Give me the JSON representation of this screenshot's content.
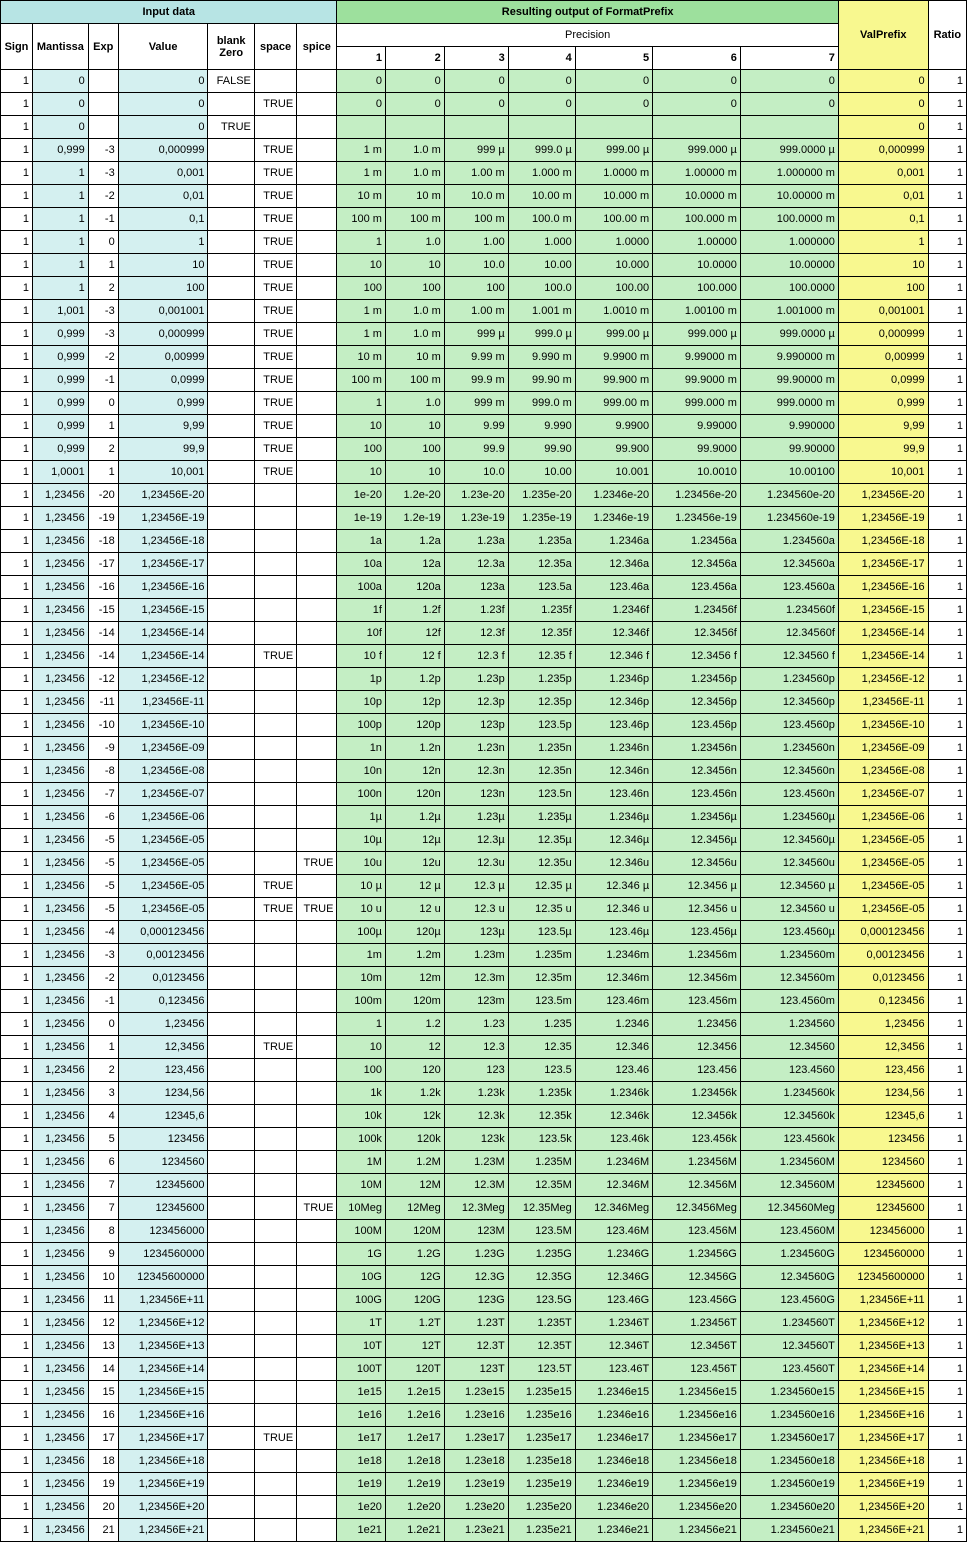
{
  "headers": {
    "input": "Input data",
    "output": "Resulting output of FormatPrefix",
    "precision": "Precision",
    "valprefix": "ValPrefix",
    "ratio": "Ratio",
    "sign": "Sign",
    "mantissa": "Mantissa",
    "exp": "Exp",
    "value": "Value",
    "blankzero1": "blank",
    "blankzero2": "Zero",
    "space": "space",
    "spice": "spice",
    "p": [
      "1",
      "2",
      "3",
      "4",
      "5",
      "6",
      "7"
    ]
  },
  "rows": [
    [
      "1",
      "0",
      "",
      "0",
      "FALSE",
      "",
      "",
      "0",
      "0",
      "0",
      "0",
      "0",
      "0",
      "0",
      "0",
      "1"
    ],
    [
      "1",
      "0",
      "",
      "0",
      "",
      "TRUE",
      "",
      "0",
      "0",
      "0",
      "0",
      "0",
      "0",
      "0",
      "0",
      "1"
    ],
    [
      "1",
      "0",
      "",
      "0",
      "TRUE",
      "",
      "",
      "",
      "",
      "",
      "",
      "",
      "",
      "",
      "0",
      "1"
    ],
    [
      "1",
      "0,999",
      "-3",
      "0,000999",
      "",
      "TRUE",
      "",
      "1 m",
      "1.0 m",
      "999 µ",
      "999.0 µ",
      "999.00 µ",
      "999.000 µ",
      "999.0000 µ",
      "0,000999",
      "1"
    ],
    [
      "1",
      "1",
      "-3",
      "0,001",
      "",
      "TRUE",
      "",
      "1 m",
      "1.0 m",
      "1.00 m",
      "1.000 m",
      "1.0000 m",
      "1.00000 m",
      "1.000000 m",
      "0,001",
      "1"
    ],
    [
      "1",
      "1",
      "-2",
      "0,01",
      "",
      "TRUE",
      "",
      "10 m",
      "10 m",
      "10.0 m",
      "10.00 m",
      "10.000 m",
      "10.0000 m",
      "10.00000 m",
      "0,01",
      "1"
    ],
    [
      "1",
      "1",
      "-1",
      "0,1",
      "",
      "TRUE",
      "",
      "100 m",
      "100 m",
      "100 m",
      "100.0 m",
      "100.00 m",
      "100.000 m",
      "100.0000 m",
      "0,1",
      "1"
    ],
    [
      "1",
      "1",
      "0",
      "1",
      "",
      "TRUE",
      "",
      "1",
      "1.0",
      "1.00",
      "1.000",
      "1.0000",
      "1.00000",
      "1.000000",
      "1",
      "1"
    ],
    [
      "1",
      "1",
      "1",
      "10",
      "",
      "TRUE",
      "",
      "10",
      "10",
      "10.0",
      "10.00",
      "10.000",
      "10.0000",
      "10.00000",
      "10",
      "1"
    ],
    [
      "1",
      "1",
      "2",
      "100",
      "",
      "TRUE",
      "",
      "100",
      "100",
      "100",
      "100.0",
      "100.00",
      "100.000",
      "100.0000",
      "100",
      "1"
    ],
    [
      "1",
      "1,001",
      "-3",
      "0,001001",
      "",
      "TRUE",
      "",
      "1 m",
      "1.0 m",
      "1.00 m",
      "1.001 m",
      "1.0010 m",
      "1.00100 m",
      "1.001000 m",
      "0,001001",
      "1"
    ],
    [
      "1",
      "0,999",
      "-3",
      "0,000999",
      "",
      "TRUE",
      "",
      "1 m",
      "1.0 m",
      "999 µ",
      "999.0 µ",
      "999.00 µ",
      "999.000 µ",
      "999.0000 µ",
      "0,000999",
      "1"
    ],
    [
      "1",
      "0,999",
      "-2",
      "0,00999",
      "",
      "TRUE",
      "",
      "10 m",
      "10 m",
      "9.99 m",
      "9.990 m",
      "9.9900 m",
      "9.99000 m",
      "9.990000 m",
      "0,00999",
      "1"
    ],
    [
      "1",
      "0,999",
      "-1",
      "0,0999",
      "",
      "TRUE",
      "",
      "100 m",
      "100 m",
      "99.9 m",
      "99.90 m",
      "99.900 m",
      "99.9000 m",
      "99.90000 m",
      "0,0999",
      "1"
    ],
    [
      "1",
      "0,999",
      "0",
      "0,999",
      "",
      "TRUE",
      "",
      "1",
      "1.0",
      "999 m",
      "999.0 m",
      "999.00 m",
      "999.000 m",
      "999.0000 m",
      "0,999",
      "1"
    ],
    [
      "1",
      "0,999",
      "1",
      "9,99",
      "",
      "TRUE",
      "",
      "10",
      "10",
      "9.99",
      "9.990",
      "9.9900",
      "9.99000",
      "9.990000",
      "9,99",
      "1"
    ],
    [
      "1",
      "0,999",
      "2",
      "99,9",
      "",
      "TRUE",
      "",
      "100",
      "100",
      "99.9",
      "99.90",
      "99.900",
      "99.9000",
      "99.90000",
      "99,9",
      "1"
    ],
    [
      "1",
      "1,0001",
      "1",
      "10,001",
      "",
      "TRUE",
      "",
      "10",
      "10",
      "10.0",
      "10.00",
      "10.001",
      "10.0010",
      "10.00100",
      "10,001",
      "1"
    ],
    [
      "1",
      "1,23456",
      "-20",
      "1,23456E-20",
      "",
      "",
      "",
      "1e-20",
      "1.2e-20",
      "1.23e-20",
      "1.235e-20",
      "1.2346e-20",
      "1.23456e-20",
      "1.234560e-20",
      "1,23456E-20",
      "1"
    ],
    [
      "1",
      "1,23456",
      "-19",
      "1,23456E-19",
      "",
      "",
      "",
      "1e-19",
      "1.2e-19",
      "1.23e-19",
      "1.235e-19",
      "1.2346e-19",
      "1.23456e-19",
      "1.234560e-19",
      "1,23456E-19",
      "1"
    ],
    [
      "1",
      "1,23456",
      "-18",
      "1,23456E-18",
      "",
      "",
      "",
      "1a",
      "1.2a",
      "1.23a",
      "1.235a",
      "1.2346a",
      "1.23456a",
      "1.234560a",
      "1,23456E-18",
      "1"
    ],
    [
      "1",
      "1,23456",
      "-17",
      "1,23456E-17",
      "",
      "",
      "",
      "10a",
      "12a",
      "12.3a",
      "12.35a",
      "12.346a",
      "12.3456a",
      "12.34560a",
      "1,23456E-17",
      "1"
    ],
    [
      "1",
      "1,23456",
      "-16",
      "1,23456E-16",
      "",
      "",
      "",
      "100a",
      "120a",
      "123a",
      "123.5a",
      "123.46a",
      "123.456a",
      "123.4560a",
      "1,23456E-16",
      "1"
    ],
    [
      "1",
      "1,23456",
      "-15",
      "1,23456E-15",
      "",
      "",
      "",
      "1f",
      "1.2f",
      "1.23f",
      "1.235f",
      "1.2346f",
      "1.23456f",
      "1.234560f",
      "1,23456E-15",
      "1"
    ],
    [
      "1",
      "1,23456",
      "-14",
      "1,23456E-14",
      "",
      "",
      "",
      "10f",
      "12f",
      "12.3f",
      "12.35f",
      "12.346f",
      "12.3456f",
      "12.34560f",
      "1,23456E-14",
      "1"
    ],
    [
      "1",
      "1,23456",
      "-14",
      "1,23456E-14",
      "",
      "TRUE",
      "",
      "10 f",
      "12 f",
      "12.3 f",
      "12.35 f",
      "12.346 f",
      "12.3456 f",
      "12.34560 f",
      "1,23456E-14",
      "1"
    ],
    [
      "1",
      "1,23456",
      "-12",
      "1,23456E-12",
      "",
      "",
      "",
      "1p",
      "1.2p",
      "1.23p",
      "1.235p",
      "1.2346p",
      "1.23456p",
      "1.234560p",
      "1,23456E-12",
      "1"
    ],
    [
      "1",
      "1,23456",
      "-11",
      "1,23456E-11",
      "",
      "",
      "",
      "10p",
      "12p",
      "12.3p",
      "12.35p",
      "12.346p",
      "12.3456p",
      "12.34560p",
      "1,23456E-11",
      "1"
    ],
    [
      "1",
      "1,23456",
      "-10",
      "1,23456E-10",
      "",
      "",
      "",
      "100p",
      "120p",
      "123p",
      "123.5p",
      "123.46p",
      "123.456p",
      "123.4560p",
      "1,23456E-10",
      "1"
    ],
    [
      "1",
      "1,23456",
      "-9",
      "1,23456E-09",
      "",
      "",
      "",
      "1n",
      "1.2n",
      "1.23n",
      "1.235n",
      "1.2346n",
      "1.23456n",
      "1.234560n",
      "1,23456E-09",
      "1"
    ],
    [
      "1",
      "1,23456",
      "-8",
      "1,23456E-08",
      "",
      "",
      "",
      "10n",
      "12n",
      "12.3n",
      "12.35n",
      "12.346n",
      "12.3456n",
      "12.34560n",
      "1,23456E-08",
      "1"
    ],
    [
      "1",
      "1,23456",
      "-7",
      "1,23456E-07",
      "",
      "",
      "",
      "100n",
      "120n",
      "123n",
      "123.5n",
      "123.46n",
      "123.456n",
      "123.4560n",
      "1,23456E-07",
      "1"
    ],
    [
      "1",
      "1,23456",
      "-6",
      "1,23456E-06",
      "",
      "",
      "",
      "1µ",
      "1.2µ",
      "1.23µ",
      "1.235µ",
      "1.2346µ",
      "1.23456µ",
      "1.234560µ",
      "1,23456E-06",
      "1"
    ],
    [
      "1",
      "1,23456",
      "-5",
      "1,23456E-05",
      "",
      "",
      "",
      "10µ",
      "12µ",
      "12.3µ",
      "12.35µ",
      "12.346µ",
      "12.3456µ",
      "12.34560µ",
      "1,23456E-05",
      "1"
    ],
    [
      "1",
      "1,23456",
      "-5",
      "1,23456E-05",
      "",
      "",
      "TRUE",
      "10u",
      "12u",
      "12.3u",
      "12.35u",
      "12.346u",
      "12.3456u",
      "12.34560u",
      "1,23456E-05",
      "1"
    ],
    [
      "1",
      "1,23456",
      "-5",
      "1,23456E-05",
      "",
      "TRUE",
      "",
      "10 µ",
      "12 µ",
      "12.3 µ",
      "12.35 µ",
      "12.346 µ",
      "12.3456 µ",
      "12.34560 µ",
      "1,23456E-05",
      "1"
    ],
    [
      "1",
      "1,23456",
      "-5",
      "1,23456E-05",
      "",
      "TRUE",
      "TRUE",
      "10 u",
      "12 u",
      "12.3 u",
      "12.35 u",
      "12.346 u",
      "12.3456 u",
      "12.34560 u",
      "1,23456E-05",
      "1"
    ],
    [
      "1",
      "1,23456",
      "-4",
      "0,000123456",
      "",
      "",
      "",
      "100µ",
      "120µ",
      "123µ",
      "123.5µ",
      "123.46µ",
      "123.456µ",
      "123.4560µ",
      "0,000123456",
      "1"
    ],
    [
      "1",
      "1,23456",
      "-3",
      "0,00123456",
      "",
      "",
      "",
      "1m",
      "1.2m",
      "1.23m",
      "1.235m",
      "1.2346m",
      "1.23456m",
      "1.234560m",
      "0,00123456",
      "1"
    ],
    [
      "1",
      "1,23456",
      "-2",
      "0,0123456",
      "",
      "",
      "",
      "10m",
      "12m",
      "12.3m",
      "12.35m",
      "12.346m",
      "12.3456m",
      "12.34560m",
      "0,0123456",
      "1"
    ],
    [
      "1",
      "1,23456",
      "-1",
      "0,123456",
      "",
      "",
      "",
      "100m",
      "120m",
      "123m",
      "123.5m",
      "123.46m",
      "123.456m",
      "123.4560m",
      "0,123456",
      "1"
    ],
    [
      "1",
      "1,23456",
      "0",
      "1,23456",
      "",
      "",
      "",
      "1",
      "1.2",
      "1.23",
      "1.235",
      "1.2346",
      "1.23456",
      "1.234560",
      "1,23456",
      "1"
    ],
    [
      "1",
      "1,23456",
      "1",
      "12,3456",
      "",
      "TRUE",
      "",
      "10",
      "12",
      "12.3",
      "12.35",
      "12.346",
      "12.3456",
      "12.34560",
      "12,3456",
      "1"
    ],
    [
      "1",
      "1,23456",
      "2",
      "123,456",
      "",
      "",
      "",
      "100",
      "120",
      "123",
      "123.5",
      "123.46",
      "123.456",
      "123.4560",
      "123,456",
      "1"
    ],
    [
      "1",
      "1,23456",
      "3",
      "1234,56",
      "",
      "",
      "",
      "1k",
      "1.2k",
      "1.23k",
      "1.235k",
      "1.2346k",
      "1.23456k",
      "1.234560k",
      "1234,56",
      "1"
    ],
    [
      "1",
      "1,23456",
      "4",
      "12345,6",
      "",
      "",
      "",
      "10k",
      "12k",
      "12.3k",
      "12.35k",
      "12.346k",
      "12.3456k",
      "12.34560k",
      "12345,6",
      "1"
    ],
    [
      "1",
      "1,23456",
      "5",
      "123456",
      "",
      "",
      "",
      "100k",
      "120k",
      "123k",
      "123.5k",
      "123.46k",
      "123.456k",
      "123.4560k",
      "123456",
      "1"
    ],
    [
      "1",
      "1,23456",
      "6",
      "1234560",
      "",
      "",
      "",
      "1M",
      "1.2M",
      "1.23M",
      "1.235M",
      "1.2346M",
      "1.23456M",
      "1.234560M",
      "1234560",
      "1"
    ],
    [
      "1",
      "1,23456",
      "7",
      "12345600",
      "",
      "",
      "",
      "10M",
      "12M",
      "12.3M",
      "12.35M",
      "12.346M",
      "12.3456M",
      "12.34560M",
      "12345600",
      "1"
    ],
    [
      "1",
      "1,23456",
      "7",
      "12345600",
      "",
      "",
      "TRUE",
      "10Meg",
      "12Meg",
      "12.3Meg",
      "12.35Meg",
      "12.346Meg",
      "12.3456Meg",
      "12.34560Meg",
      "12345600",
      "1"
    ],
    [
      "1",
      "1,23456",
      "8",
      "123456000",
      "",
      "",
      "",
      "100M",
      "120M",
      "123M",
      "123.5M",
      "123.46M",
      "123.456M",
      "123.4560M",
      "123456000",
      "1"
    ],
    [
      "1",
      "1,23456",
      "9",
      "1234560000",
      "",
      "",
      "",
      "1G",
      "1.2G",
      "1.23G",
      "1.235G",
      "1.2346G",
      "1.23456G",
      "1.234560G",
      "1234560000",
      "1"
    ],
    [
      "1",
      "1,23456",
      "10",
      "12345600000",
      "",
      "",
      "",
      "10G",
      "12G",
      "12.3G",
      "12.35G",
      "12.346G",
      "12.3456G",
      "12.34560G",
      "12345600000",
      "1"
    ],
    [
      "1",
      "1,23456",
      "11",
      "1,23456E+11",
      "",
      "",
      "",
      "100G",
      "120G",
      "123G",
      "123.5G",
      "123.46G",
      "123.456G",
      "123.4560G",
      "1,23456E+11",
      "1"
    ],
    [
      "1",
      "1,23456",
      "12",
      "1,23456E+12",
      "",
      "",
      "",
      "1T",
      "1.2T",
      "1.23T",
      "1.235T",
      "1.2346T",
      "1.23456T",
      "1.234560T",
      "1,23456E+12",
      "1"
    ],
    [
      "1",
      "1,23456",
      "13",
      "1,23456E+13",
      "",
      "",
      "",
      "10T",
      "12T",
      "12.3T",
      "12.35T",
      "12.346T",
      "12.3456T",
      "12.34560T",
      "1,23456E+13",
      "1"
    ],
    [
      "1",
      "1,23456",
      "14",
      "1,23456E+14",
      "",
      "",
      "",
      "100T",
      "120T",
      "123T",
      "123.5T",
      "123.46T",
      "123.456T",
      "123.4560T",
      "1,23456E+14",
      "1"
    ],
    [
      "1",
      "1,23456",
      "15",
      "1,23456E+15",
      "",
      "",
      "",
      "1e15",
      "1.2e15",
      "1.23e15",
      "1.235e15",
      "1.2346e15",
      "1.23456e15",
      "1.234560e15",
      "1,23456E+15",
      "1"
    ],
    [
      "1",
      "1,23456",
      "16",
      "1,23456E+16",
      "",
      "",
      "",
      "1e16",
      "1.2e16",
      "1.23e16",
      "1.235e16",
      "1.2346e16",
      "1.23456e16",
      "1.234560e16",
      "1,23456E+16",
      "1"
    ],
    [
      "1",
      "1,23456",
      "17",
      "1,23456E+17",
      "",
      "TRUE",
      "",
      "1e17",
      "1.2e17",
      "1.23e17",
      "1.235e17",
      "1.2346e17",
      "1.23456e17",
      "1.234560e17",
      "1,23456E+17",
      "1"
    ],
    [
      "1",
      "1,23456",
      "18",
      "1,23456E+18",
      "",
      "",
      "",
      "1e18",
      "1.2e18",
      "1.23e18",
      "1.235e18",
      "1.2346e18",
      "1.23456e18",
      "1.234560e18",
      "1,23456E+18",
      "1"
    ],
    [
      "1",
      "1,23456",
      "19",
      "1,23456E+19",
      "",
      "",
      "",
      "1e19",
      "1.2e19",
      "1.23e19",
      "1.235e19",
      "1.2346e19",
      "1.23456e19",
      "1.234560e19",
      "1,23456E+19",
      "1"
    ],
    [
      "1",
      "1,23456",
      "20",
      "1,23456E+20",
      "",
      "",
      "",
      "1e20",
      "1.2e20",
      "1.23e20",
      "1.235e20",
      "1.2346e20",
      "1.23456e20",
      "1.234560e20",
      "1,23456E+20",
      "1"
    ],
    [
      "1",
      "1,23456",
      "21",
      "1,23456E+21",
      "",
      "",
      "",
      "1e21",
      "1.2e21",
      "1.23e21",
      "1.235e21",
      "1.2346e21",
      "1.23456e21",
      "1.234560e21",
      "1,23456E+21",
      "1"
    ]
  ]
}
